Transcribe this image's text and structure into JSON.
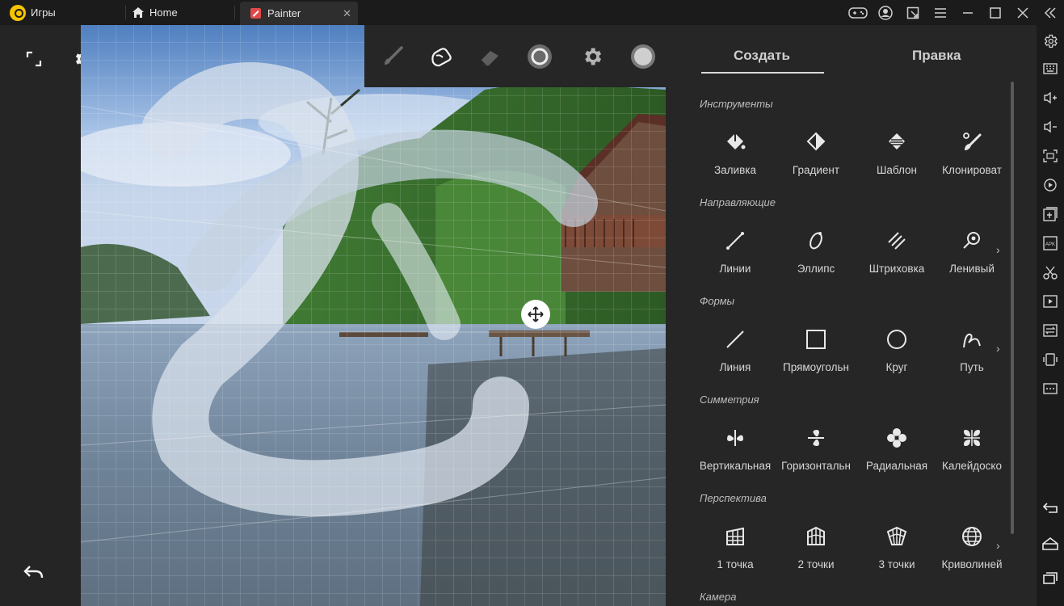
{
  "window": {
    "games_tab": "Игры",
    "home_tab": "Home",
    "app_tab": "Painter"
  },
  "palette": {
    "tools": [
      "brush-icon",
      "smudge-icon",
      "eraser-icon",
      "brush-size-icon",
      "settings-icon",
      "color-icon"
    ]
  },
  "panel": {
    "tabs": [
      "Создать",
      "Правка"
    ],
    "sections": [
      {
        "title": "Инструменты",
        "items": [
          "Заливка",
          "Градиент",
          "Шаблон",
          "Клонироват"
        ],
        "more": false
      },
      {
        "title": "Направляющие",
        "items": [
          "Линии",
          "Эллипс",
          "Штриховка",
          "Ленивый"
        ],
        "more": true
      },
      {
        "title": "Формы",
        "items": [
          "Линия",
          "Прямоугольн",
          "Круг",
          "Путь"
        ],
        "more": true
      },
      {
        "title": "Симметрия",
        "items": [
          "Вертикальная",
          "Горизонтальн",
          "Радиальная",
          "Калейдоско"
        ],
        "more": false
      },
      {
        "title": "Перспектива",
        "items": [
          "1 точка",
          "2 точки",
          "3 точки",
          "Криволиней"
        ],
        "more": true
      },
      {
        "title": "Камера",
        "items": [],
        "more": false
      }
    ],
    "chevron": "›"
  },
  "colors": {
    "accent": "#d8d8d8",
    "panel_bg": "#262626",
    "titlebar_bg": "#1b1b1b"
  }
}
